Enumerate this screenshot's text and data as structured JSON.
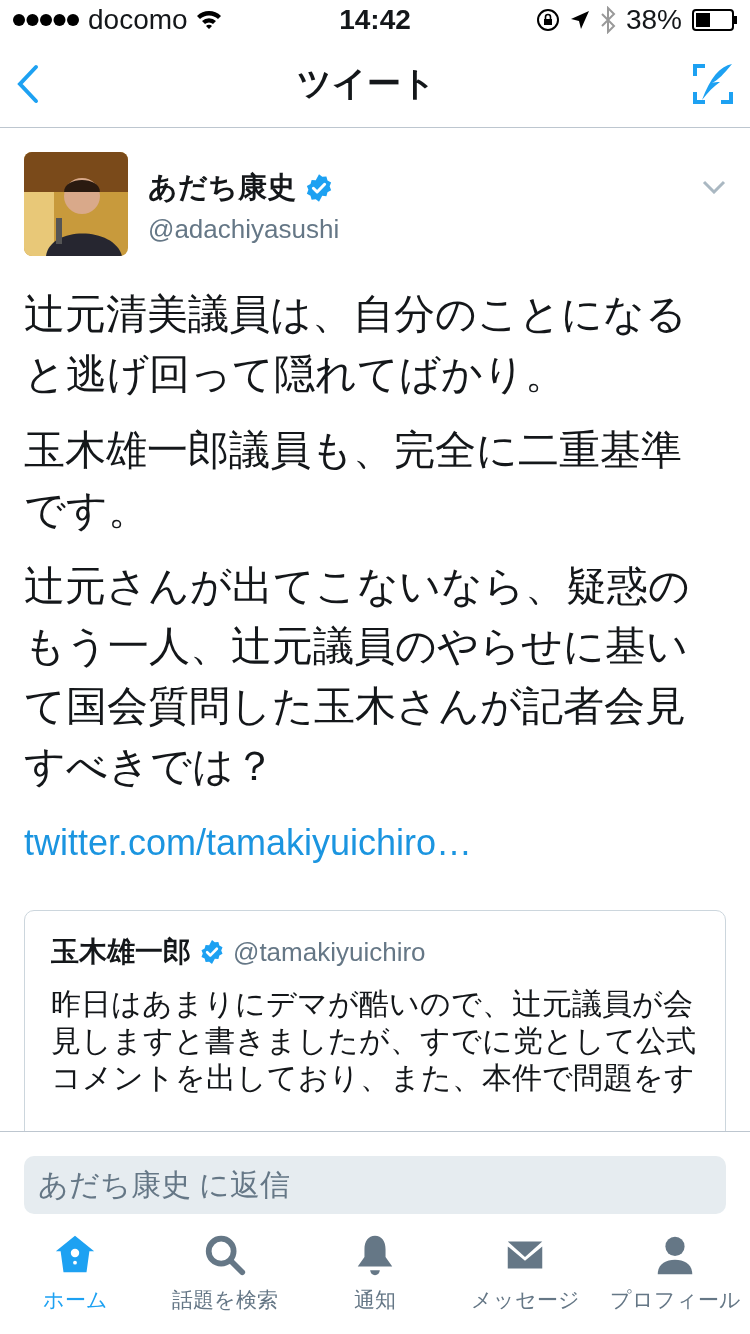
{
  "status_bar": {
    "carrier": "docomo",
    "time": "14:42",
    "battery": "38%"
  },
  "nav": {
    "title": "ツイート"
  },
  "tweet": {
    "name": "あだち康史",
    "verified": true,
    "handle": "@adachiyasushi",
    "paragraphs": [
      "辻元清美議員は、自分のことになると逃げ回って隠れてばかり。",
      "玉木雄一郎議員も、完全に二重基準です。",
      "辻元さんが出てこないなら、疑惑のもう一人、辻元議員のやらせに基いて国会質問した玉木さんが記者会見すべきでは？"
    ],
    "link": "twitter.com/tamakiyuichiro…",
    "quoted": {
      "name": "玉木雄一郎",
      "verified": true,
      "handle": "@tamakiyuichiro",
      "text": "昨日はあまりにデマが酷いので、辻元議員が会見しますと書きましたが、すでに党として公式コメントを出しており、また、本件で問題をす"
    }
  },
  "reply": {
    "placeholder": "あだち康史 に返信"
  },
  "tabs": [
    {
      "kind": "home",
      "label": "ホーム",
      "selected": true
    },
    {
      "kind": "search",
      "label": "話題を検索",
      "selected": false
    },
    {
      "kind": "bell",
      "label": "通知",
      "selected": false
    },
    {
      "kind": "mail",
      "label": "メッセージ",
      "selected": false
    },
    {
      "kind": "profile",
      "label": "プロフィール",
      "selected": false
    }
  ]
}
